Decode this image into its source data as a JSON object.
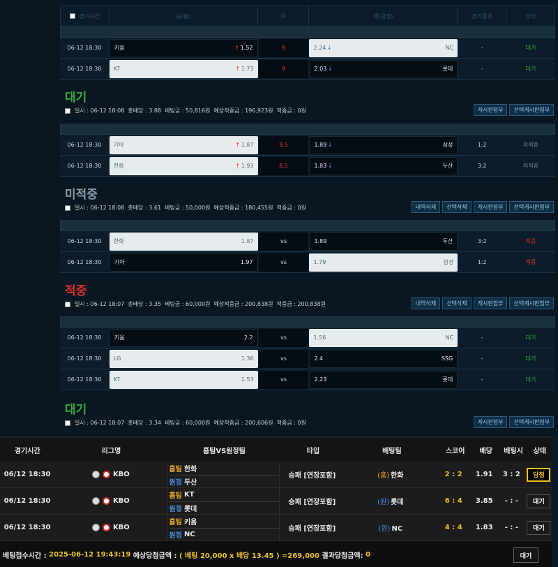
{
  "header": {
    "col_time": "경기시간",
    "col_home": "승(홈)",
    "col_draw": "무",
    "col_away": "패(원정)",
    "col_result": "경기결과",
    "col_status": "상태"
  },
  "groups": [
    {
      "rows": [
        {
          "time": "06-12 18:30",
          "home": "키움",
          "home_odds": "1.52",
          "home_sel": "dark",
          "home_arrow": "up",
          "mid": "9",
          "mid_red": true,
          "away": "NC",
          "away_odds": "2.24",
          "away_sel": "light",
          "away_arrow": "down",
          "result": "-",
          "status": "대기"
        },
        {
          "time": "06-12 18:30",
          "home": "KT",
          "home_odds": "1.73",
          "home_sel": "light",
          "home_arrow": "up",
          "mid": "9",
          "mid_red": true,
          "away": "롯데",
          "away_odds": "2.03",
          "away_sel": "dark",
          "away_arrow": "down",
          "result": "-",
          "status": "대기"
        }
      ],
      "title": "대기",
      "title_class": "st-wait",
      "summary": "일시 : 06-12 18:08  총배당 : 3.88  베팅금 : 50,816원  예상적중금 : 196,923원  적중금 : 0원",
      "buttons": [
        "게시판첨부",
        "선택게시판첨부"
      ]
    },
    {
      "rows": [
        {
          "time": "06-12 18:30",
          "home": "기아",
          "home_odds": "1.87",
          "home_sel": "light",
          "home_arrow": "up",
          "mid": "9.5",
          "mid_red": true,
          "away": "삼성",
          "away_odds": "1.89",
          "away_sel": "dark",
          "away_arrow": "down",
          "result": "1:2",
          "status": "미적중"
        },
        {
          "time": "06-12 18:30",
          "home": "한화",
          "home_odds": "1.93",
          "home_sel": "light",
          "home_arrow": "up",
          "mid": "8.5",
          "mid_red": true,
          "away": "두산",
          "away_odds": "1.83",
          "away_sel": "dark",
          "away_arrow": "down",
          "result": "3:2",
          "status": "미적중"
        }
      ],
      "title": "미적중",
      "title_class": "st-miss",
      "summary": "일시 : 06-12 18:08  총배당 : 3.61  베팅금 : 50,000원  예상적중금 : 180,455원  적중금 : 0원",
      "buttons": [
        "내역삭제",
        "선택삭제",
        "게시판첨부",
        "선택게시판첨부"
      ]
    },
    {
      "rows": [
        {
          "time": "06-12 18:30",
          "home": "한화",
          "home_odds": "1.87",
          "home_sel": "light",
          "home_arrow": "",
          "mid": "vs",
          "mid_red": false,
          "away": "두산",
          "away_odds": "1.89",
          "away_sel": "dark",
          "away_arrow": "",
          "result": "3:2",
          "status": "적중"
        },
        {
          "time": "06-12 18:30",
          "home": "기아",
          "home_odds": "1.97",
          "home_sel": "dark",
          "home_arrow": "",
          "mid": "vs",
          "mid_red": false,
          "away": "삼성",
          "away_odds": "1.79",
          "away_sel": "light",
          "away_arrow": "",
          "result": "1:2",
          "status": "적중"
        }
      ],
      "title": "적중",
      "title_class": "st-hit",
      "summary": "일시 : 06-12 18:07  총배당 : 3.35  베팅금 : 60,000원  예상적중금 : 200,838원  적중금 : 200,838원",
      "buttons": [
        "내역삭제",
        "선택삭제",
        "게시판첨부",
        "선택게시판첨부"
      ]
    },
    {
      "rows": [
        {
          "time": "06-12 18:30",
          "home": "키움",
          "home_odds": "2.2",
          "home_sel": "dark",
          "home_arrow": "",
          "mid": "vs",
          "mid_red": false,
          "away": "NC",
          "away_odds": "1.56",
          "away_sel": "light",
          "away_arrow": "",
          "result": "-",
          "status": "대기"
        },
        {
          "time": "06-12 18:30",
          "home": "LG",
          "home_odds": "1.36",
          "home_sel": "light",
          "home_arrow": "",
          "mid": "vs",
          "mid_red": false,
          "away": "SSG",
          "away_odds": "2.4",
          "away_sel": "dark",
          "away_arrow": "",
          "result": "-",
          "status": "대기"
        },
        {
          "time": "06-12 18:30",
          "home": "KT",
          "home_odds": "1.53",
          "home_sel": "light",
          "home_arrow": "",
          "mid": "vs",
          "mid_red": false,
          "away": "롯데",
          "away_odds": "2.23",
          "away_sel": "dark",
          "away_arrow": "",
          "result": "-",
          "status": "대기"
        }
      ],
      "title": "대기",
      "title_class": "st-wait",
      "summary": "일시 : 06-12 18:07  총배당 : 3.34  베팅금 : 60,000원  예상적중금 : 200,606원  적중금 : 0원",
      "buttons": [
        "게시판첨부",
        "선택게시판첨부"
      ]
    }
  ],
  "slip": {
    "headers": {
      "time": "경기시간",
      "league": "리그명",
      "teams": "홈팀VS원정팀",
      "type": "타입",
      "bet": "베팅팀",
      "score": "스코어",
      "odds": "배당",
      "bet_time": "베팅시",
      "state": "상태"
    },
    "home_label": "홈팀",
    "away_label": "원정",
    "rows": [
      {
        "time": "06/12 18:30",
        "league": "KBO",
        "home": "한화",
        "away": "두산",
        "type": "승패 [연장포함]",
        "pick_tag": "(홈)",
        "pick_tag_class": "bet-pick-home",
        "pick": "한화",
        "score": "2 : 2",
        "odds": "1.91",
        "bet_score": "3 : 2",
        "state": "당첨",
        "state_win": true
      },
      {
        "time": "06/12 18:30",
        "league": "KBO",
        "home": "KT",
        "away": "롯데",
        "type": "승패 [연장포함]",
        "pick_tag": "(원)",
        "pick_tag_class": "bet-pick-away",
        "pick": "롯데",
        "score": "6 : 4",
        "odds": "3.85",
        "bet_score": "- : -",
        "state": "대기",
        "state_win": false
      },
      {
        "time": "06/12 18:30",
        "league": "KBO",
        "home": "키움",
        "away": "NC",
        "type": "승패 [연장포함]",
        "pick_tag": "(원)",
        "pick_tag_class": "bet-pick-away",
        "pick": "NC",
        "score": "4 : 4",
        "odds": "1.83",
        "bet_score": "- : -",
        "state": "대기",
        "state_win": false
      }
    ],
    "footer": {
      "label_time": "베팅접수시간 :",
      "time": "2025-06-12 19:43:19",
      "label_expected": "예상당첨금액 :",
      "calc": "( 베팅 20,000 x 배당 13.45 ) =269,000",
      "label_result": "결과당첨금액:",
      "result": "0",
      "button": "대기"
    }
  }
}
